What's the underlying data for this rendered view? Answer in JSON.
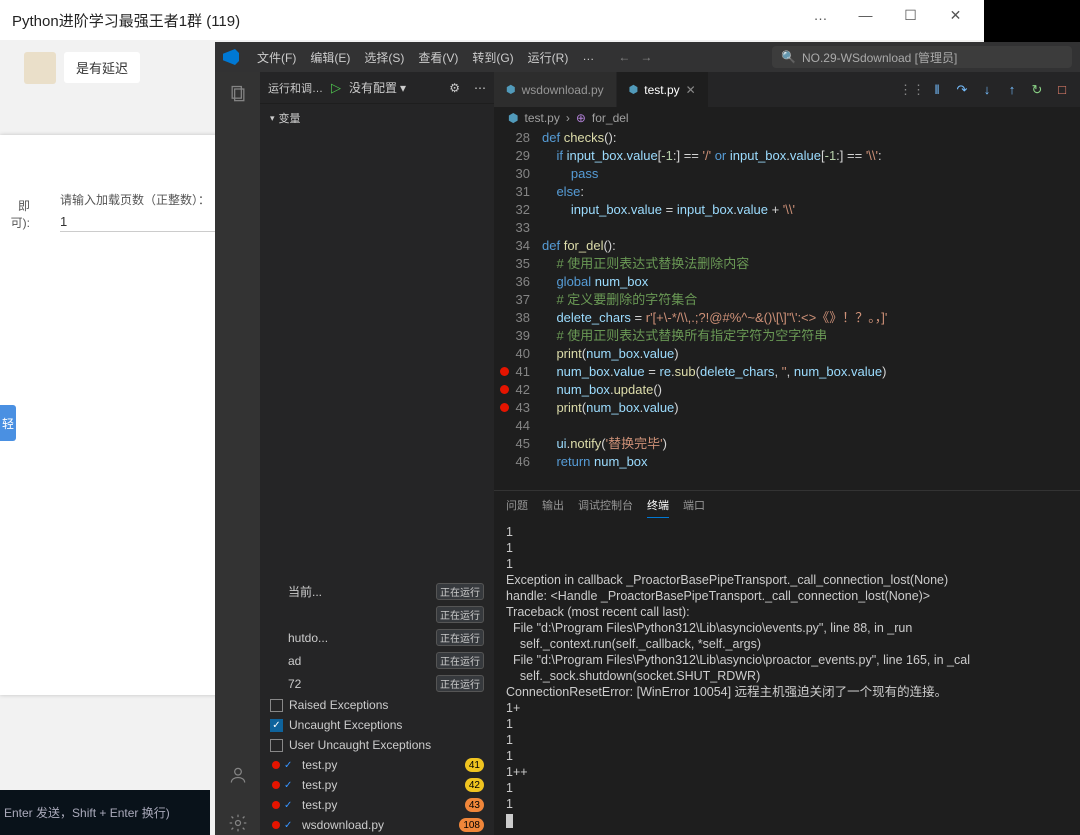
{
  "chat": {
    "title": "Python进阶学习最强王者1群 (119)",
    "win_controls": {
      "min": "—",
      "max": "☐",
      "close": "✕",
      "more": "…"
    },
    "message": "是有延迟",
    "input_hint": "Enter 发送，Shift + Enter 换行)"
  },
  "dialog": {
    "win": {
      "min": "—",
      "max": "☐",
      "close": "✕"
    },
    "left_label": "即可):",
    "field_label": "请输入加载页数（正整数）：",
    "field_value": "1",
    "blue_btn": "轻"
  },
  "vscode": {
    "menu": [
      "文件(F)",
      "编辑(E)",
      "选择(S)",
      "查看(V)",
      "转到(G)",
      "运行(R)",
      "…"
    ],
    "nav": {
      "back": "←",
      "fwd": "→"
    },
    "search_icon": "🔍",
    "search_text": "NO.29-WSdownload [管理员]",
    "sidebar": {
      "run_debug": "运行和调…",
      "play": "▷",
      "config": "没有配置",
      "chev": "▾",
      "gear": "⚙",
      "dots": "⋯",
      "section": "变量",
      "statuses": [
        {
          "text": "当前...",
          "tag": "正在运行"
        },
        {
          "text": "",
          "tag": "正在运行"
        },
        {
          "text": "hutdo...",
          "tag": "正在运行"
        },
        {
          "text": "ad",
          "tag": "正在运行"
        },
        {
          "text": "72",
          "tag": "正在运行"
        }
      ],
      "exceptions": {
        "raised": {
          "label": "Raised Exceptions",
          "checked": false
        },
        "uncaught": {
          "label": "Uncaught Exceptions",
          "checked": true
        },
        "user": {
          "label": "User Uncaught Exceptions",
          "checked": false
        }
      },
      "bp_files": [
        {
          "name": "test.py",
          "badge": "41",
          "color": "#f0c420"
        },
        {
          "name": "test.py",
          "badge": "42",
          "color": "#f0c420"
        },
        {
          "name": "test.py",
          "badge": "43",
          "color": "#f0863a"
        },
        {
          "name": "wsdownload.py",
          "badge": "108",
          "color": "#f0863a"
        }
      ]
    },
    "tabs": [
      {
        "icon": "⬢",
        "label": "wsdownload.py",
        "active": false
      },
      {
        "icon": "⬢",
        "label": "test.py",
        "active": true
      }
    ],
    "debug_toolbar": {
      "handle": "⋮⋮",
      "cont": "▶",
      "pause": "‖",
      "over": "↷",
      "into": "↓",
      "out": "↑",
      "restart": "↻",
      "stop": "□"
    },
    "breadcrumb": {
      "file": "test.py",
      "sep": "›",
      "fn": "for_del"
    },
    "code": [
      {
        "n": 28,
        "html": "<span class='kw'>def</span> <span class='fn'>checks</span><span class='pun'>():</span>"
      },
      {
        "n": 29,
        "html": "    <span class='kw'>if</span> <span class='var'>input_box</span><span class='pun'>.</span><span class='var'>value</span><span class='pun'>[</span><span class='num'>-1</span><span class='pun'>:] == </span><span class='str'>'/'</span> <span class='kw'>or</span> <span class='var'>input_box</span><span class='pun'>.</span><span class='var'>value</span><span class='pun'>[</span><span class='num'>-1</span><span class='pun'>:] == </span><span class='str'>'\\\\'</span><span class='pun'>:</span>"
      },
      {
        "n": 30,
        "html": "        <span class='kw'>pass</span>"
      },
      {
        "n": 31,
        "html": "    <span class='kw'>else</span><span class='pun'>:</span>"
      },
      {
        "n": 32,
        "html": "        <span class='var'>input_box</span><span class='pun'>.</span><span class='var'>value</span> <span class='pun'>=</span> <span class='var'>input_box</span><span class='pun'>.</span><span class='var'>value</span> <span class='pun'>+</span> <span class='str'>'\\\\'</span>"
      },
      {
        "n": 33,
        "html": ""
      },
      {
        "n": 34,
        "html": "<span class='kw'>def</span> <span class='fn'>for_del</span><span class='pun'>():</span>"
      },
      {
        "n": 35,
        "html": "    <span class='cm'># 使用正则表达式替换法删除内容</span>"
      },
      {
        "n": 36,
        "html": "    <span class='kw'>global</span> <span class='var'>num_box</span>"
      },
      {
        "n": 37,
        "html": "    <span class='cm'># 定义要删除的字符集合</span>"
      },
      {
        "n": 38,
        "html": "    <span class='var'>delete_chars</span> <span class='pun'>=</span> <span class='str'>r'[+\\-*/\\\\,.;?!@#%^~&()\\[\\]\"\\':&lt;&gt;《》！？。，]'</span>"
      },
      {
        "n": 39,
        "html": "    <span class='cm'># 使用正则表达式替换所有指定字符为空字符串</span>"
      },
      {
        "n": 40,
        "html": "    <span class='fn'>print</span><span class='pun'>(</span><span class='var'>num_box</span><span class='pun'>.</span><span class='var'>value</span><span class='pun'>)</span>"
      },
      {
        "n": 41,
        "bp": true,
        "html": "    <span class='var'>num_box</span><span class='pun'>.</span><span class='var'>value</span> <span class='pun'>=</span> <span class='var'>re</span><span class='pun'>.</span><span class='fn'>sub</span><span class='pun'>(</span><span class='var'>delete_chars</span><span class='pun'>, </span><span class='str'>''</span><span class='pun'>, </span><span class='var'>num_box</span><span class='pun'>.</span><span class='var'>value</span><span class='pun'>)</span>"
      },
      {
        "n": 42,
        "bp": true,
        "html": "    <span class='var'>num_box</span><span class='pun'>.</span><span class='fn'>update</span><span class='pun'>()</span>"
      },
      {
        "n": 43,
        "bp": true,
        "html": "    <span class='fn'>print</span><span class='pun'>(</span><span class='var'>num_box</span><span class='pun'>.</span><span class='var'>value</span><span class='pun'>)</span>"
      },
      {
        "n": 44,
        "html": ""
      },
      {
        "n": 45,
        "html": "    <span class='var'>ui</span><span class='pun'>.</span><span class='fn'>notify</span><span class='pun'>(</span><span class='str'>'替换完毕'</span><span class='pun'>)</span>"
      },
      {
        "n": 46,
        "html": "    <span class='kw'>return</span> <span class='var'>num_box</span>"
      }
    ],
    "panel_tabs": [
      "问题",
      "输出",
      "调试控制台",
      "终端",
      "端口"
    ],
    "panel_active": 3,
    "terminal_lines": [
      "1",
      "1",
      "1",
      "Exception in callback _ProactorBasePipeTransport._call_connection_lost(None)",
      "handle: <Handle _ProactorBasePipeTransport._call_connection_lost(None)>",
      "Traceback (most recent call last):",
      "  File \"d:\\Program Files\\Python312\\Lib\\asyncio\\events.py\", line 88, in _run",
      "    self._context.run(self._callback, *self._args)",
      "  File \"d:\\Program Files\\Python312\\Lib\\asyncio\\proactor_events.py\", line 165, in _cal",
      "    self._sock.shutdown(socket.SHUT_RDWR)",
      "ConnectionResetError: [WinError 10054] 远程主机强迫关闭了一个现有的连接。",
      "1+",
      "1",
      "1",
      "1",
      "1++",
      "1",
      "1"
    ]
  }
}
